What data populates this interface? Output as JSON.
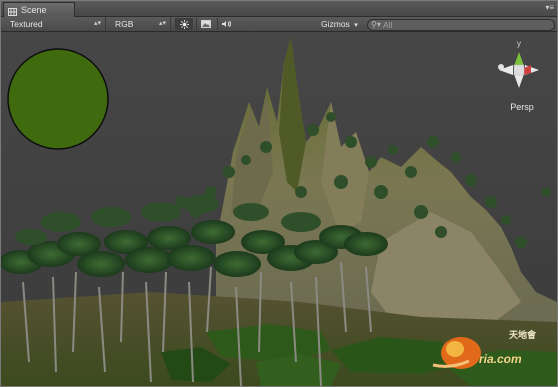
{
  "tab": {
    "label": "Scene",
    "icon": "grid-icon"
  },
  "toolbar": {
    "render_mode": "Textured",
    "color_mode": "RGB",
    "lighting_icon": "sun-icon",
    "image_icon": "image-icon",
    "audio_icon": "speaker-icon",
    "gizmos_label": "Gizmos",
    "search_placeholder": "All"
  },
  "gizmo": {
    "projection_label": "Persp",
    "axis_y_label": "y"
  },
  "watermark": {
    "text": "天地會",
    "logo": "9ria.com"
  },
  "colors": {
    "panel": "#3b3b3b",
    "toolbar": "#535353",
    "sphere": "#3f6b0e",
    "terrain": "#6f6f48",
    "grass": "#2d4f17"
  }
}
